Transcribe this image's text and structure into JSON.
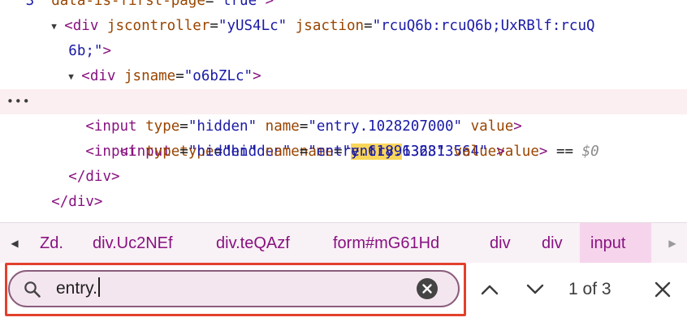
{
  "code_lines": [
    {
      "indent": "   ",
      "tokens": [
        {
          "t": "attr-value",
          "v": "3\""
        },
        {
          "t": "plain",
          "v": " "
        },
        {
          "t": "attr-name",
          "v": "data-is-first-page"
        },
        {
          "t": "plain",
          "v": "="
        },
        {
          "t": "attr-value",
          "v": "\"true\""
        },
        {
          "t": "tag",
          "v": ">"
        }
      ]
    },
    {
      "indent": "      ",
      "toggle": "expanded",
      "tokens": [
        {
          "t": "tag",
          "v": "<div"
        },
        {
          "t": "plain",
          "v": " "
        },
        {
          "t": "attr-name",
          "v": "jscontroller"
        },
        {
          "t": "plain",
          "v": "="
        },
        {
          "t": "attr-value",
          "v": "\"yUS4Lc\""
        },
        {
          "t": "plain",
          "v": " "
        },
        {
          "t": "attr-name",
          "v": "jsaction"
        },
        {
          "t": "plain",
          "v": "="
        },
        {
          "t": "attr-value",
          "v": "\"rcuQ6b:rcuQ6b;UxRBlf:rcuQ"
        }
      ]
    },
    {
      "indent": "        ",
      "tokens": [
        {
          "t": "attr-value",
          "v": "6b;\""
        },
        {
          "t": "tag",
          "v": ">"
        }
      ]
    },
    {
      "indent": "        ",
      "toggle": "expanded",
      "tokens": [
        {
          "t": "tag",
          "v": "<div"
        },
        {
          "t": "plain",
          "v": " "
        },
        {
          "t": "attr-name",
          "v": "jsname"
        },
        {
          "t": "plain",
          "v": "="
        },
        {
          "t": "attr-value",
          "v": "\"o6bZLc\""
        },
        {
          "t": "tag",
          "v": ">"
        }
      ]
    },
    {
      "indent": "          ",
      "selected": true,
      "tokens": [
        {
          "t": "tag",
          "v": "<input"
        },
        {
          "t": "plain",
          "v": " "
        },
        {
          "t": "attr-name",
          "v": "type"
        },
        {
          "t": "plain",
          "v": "="
        },
        {
          "t": "attr-value",
          "v": "\"hidden\""
        },
        {
          "t": "plain",
          "v": " "
        },
        {
          "t": "attr-name",
          "v": "name"
        },
        {
          "t": "plain",
          "v": "="
        },
        {
          "t": "attr-value",
          "v": "\""
        },
        {
          "t": "highlight",
          "v": "entry."
        },
        {
          "t": "attr-value",
          "v": "136813564\""
        },
        {
          "t": "plain",
          "v": " "
        },
        {
          "t": "attr-name",
          "v": "value"
        },
        {
          "t": "tag",
          "v": ">"
        },
        {
          "t": "plain",
          "v": " == "
        },
        {
          "t": "dollar",
          "v": "$0"
        }
      ]
    },
    {
      "indent": "          ",
      "tokens": [
        {
          "t": "tag",
          "v": "<input"
        },
        {
          "t": "plain",
          "v": " "
        },
        {
          "t": "attr-name",
          "v": "type"
        },
        {
          "t": "plain",
          "v": "="
        },
        {
          "t": "attr-value",
          "v": "\"hidden\""
        },
        {
          "t": "plain",
          "v": " "
        },
        {
          "t": "attr-name",
          "v": "name"
        },
        {
          "t": "plain",
          "v": "="
        },
        {
          "t": "attr-value",
          "v": "\"entry.1028207000\""
        },
        {
          "t": "plain",
          "v": " "
        },
        {
          "t": "attr-name",
          "v": "value"
        },
        {
          "t": "tag",
          "v": ">"
        }
      ]
    },
    {
      "indent": "          ",
      "tokens": [
        {
          "t": "tag",
          "v": "<input"
        },
        {
          "t": "plain",
          "v": " "
        },
        {
          "t": "attr-name",
          "v": "type"
        },
        {
          "t": "plain",
          "v": "="
        },
        {
          "t": "attr-value",
          "v": "\"hidden\""
        },
        {
          "t": "plain",
          "v": " "
        },
        {
          "t": "attr-name",
          "v": "name"
        },
        {
          "t": "plain",
          "v": "="
        },
        {
          "t": "attr-value",
          "v": "\"entry.61896323\""
        },
        {
          "t": "plain",
          "v": " "
        },
        {
          "t": "attr-name",
          "v": "value"
        },
        {
          "t": "tag",
          "v": ">"
        }
      ]
    },
    {
      "indent": "        ",
      "tokens": [
        {
          "t": "tag",
          "v": "</div>"
        }
      ]
    },
    {
      "indent": "      ",
      "tokens": [
        {
          "t": "tag",
          "v": "</div>"
        }
      ]
    }
  ],
  "selected_line_ellipsis": "•••",
  "breadcrumbs": {
    "items": [
      {
        "label": "Zd."
      },
      {
        "label": "div.Uc2NEf"
      },
      {
        "label": "div.teQAzf"
      },
      {
        "label": "form#mG61Hd"
      },
      {
        "label": "div"
      },
      {
        "label": "div"
      },
      {
        "label": "input",
        "active": true
      }
    ],
    "scroll_left_icon": "triangle-left-icon",
    "scroll_right_icon": "triangle-right-icon"
  },
  "search": {
    "query": "entry.",
    "match_count": "1 of 3",
    "icons": {
      "search": "search-icon",
      "clear": "clear-icon",
      "previous": "chevron-up-icon",
      "next": "chevron-down-icon",
      "close": "close-icon"
    }
  },
  "colors": {
    "tag": "#881280",
    "attr_name": "#994500",
    "attr_value": "#1a1aa6",
    "match_highlight": "#f9d65a",
    "selected_row": "#fbeff1",
    "breadcrumb_bar": "#f8f1f6",
    "breadcrumb_active": "#f6d5ec",
    "focus_outline": "#e2402d",
    "search_pill": "#f4e6ef"
  }
}
